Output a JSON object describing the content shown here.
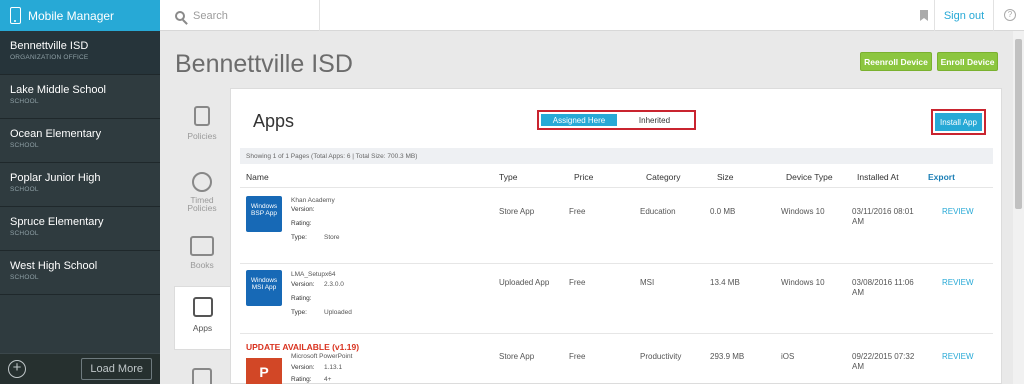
{
  "sidebar": {
    "title": "Mobile Manager",
    "orgs": [
      {
        "name": "Bennettville ISD",
        "type": "ORGANIZATION OFFICE"
      },
      {
        "name": "Lake Middle School",
        "type": "SCHOOL"
      },
      {
        "name": "Ocean Elementary",
        "type": "SCHOOL"
      },
      {
        "name": "Poplar Junior High",
        "type": "SCHOOL"
      },
      {
        "name": "Spruce Elementary",
        "type": "SCHOOL"
      },
      {
        "name": "West High School",
        "type": "SCHOOL"
      }
    ],
    "load_more": "Load More"
  },
  "topbar": {
    "search_placeholder": "Search",
    "sign_out": "Sign out"
  },
  "page": {
    "title": "Bennettville ISD",
    "reenroll": "Reenroll Device",
    "enroll": "Enroll Device"
  },
  "side_tabs": {
    "policies": "Policies",
    "timed_policies": "Timed Policies",
    "books": "Books",
    "apps": "Apps"
  },
  "apps": {
    "heading": "Apps",
    "seg_assigned": "Assigned Here",
    "seg_inherited": "Inherited",
    "install": "Install App",
    "info": "Showing 1 of 1 Pages (Total Apps: 6 | Total Size: 700.3 MB)",
    "columns": {
      "name": "Name",
      "type": "Type",
      "price": "Price",
      "category": "Category",
      "size": "Size",
      "device_type": "Device Type",
      "installed_at": "Installed At",
      "export": "Export"
    },
    "labels": {
      "version": "Version:",
      "rating": "Rating:",
      "type": "Type:"
    },
    "rows": [
      {
        "tile": "Windows BSP App",
        "name": "Khan Academy",
        "version": "",
        "rating": "",
        "meta_type": "Store",
        "type": "Store App",
        "price": "Free",
        "category": "Education",
        "size": "0.0 MB",
        "device": "Windows 10",
        "installed": "03/11/2016 08:01 AM",
        "action": "REVIEW"
      },
      {
        "tile": "Windows MSI App",
        "name": "LMA_Setupx64",
        "version": "2.3.0.0",
        "rating": "",
        "meta_type": "Uploaded",
        "type": "Uploaded App",
        "price": "Free",
        "category": "MSI",
        "size": "13.4 MB",
        "device": "Windows 10",
        "installed": "03/08/2016 11:06 AM",
        "action": "REVIEW"
      },
      {
        "update": "UPDATE AVAILABLE (v1.19)",
        "tile": "P",
        "name": "Microsoft PowerPoint",
        "version": "1.13.1",
        "rating": "4+",
        "type": "Store App",
        "price": "Free",
        "category": "Productivity",
        "size": "293.9 MB",
        "device": "iOS",
        "installed": "09/22/2015 07:32 AM",
        "action": "REVIEW"
      }
    ]
  },
  "colors": {
    "accent": "#27a9d6",
    "green": "#8cc63f",
    "highlight": "#c9242f",
    "update": "#d9321f"
  }
}
